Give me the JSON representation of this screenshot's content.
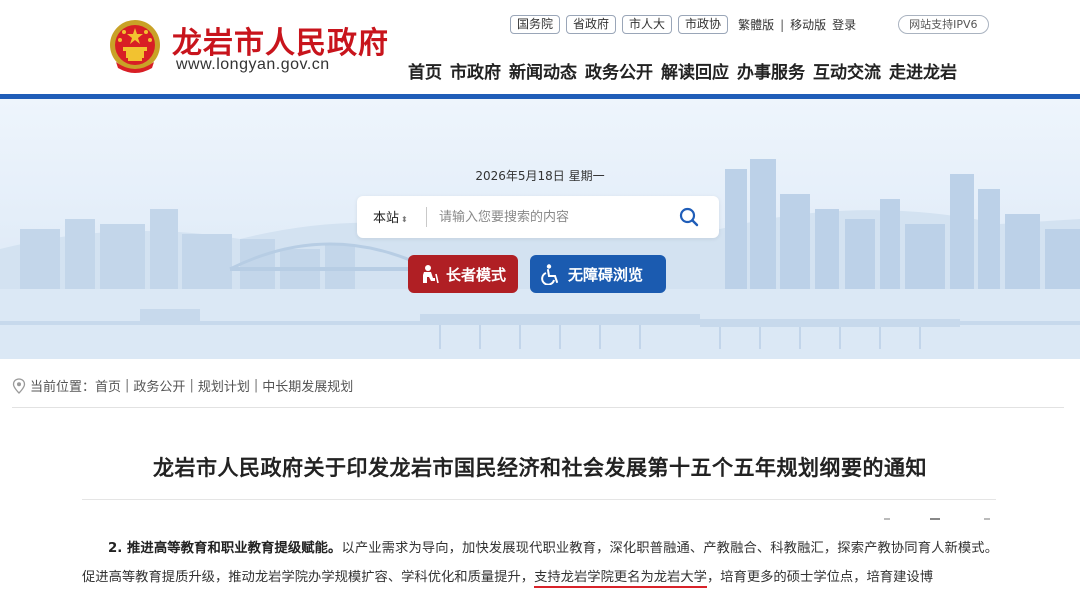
{
  "header": {
    "site_name": "龙岩市人民政府",
    "site_url": "www.longyan.gov.cn",
    "gov_links": [
      "国务院",
      "省政府",
      "市人大",
      "市政协"
    ],
    "traditional": "繁體版",
    "mobile": "移动版",
    "login": "登录",
    "ipv6": "网站支持IPV6",
    "nav": [
      "首页",
      "市政府",
      "新闻动态",
      "政务公开",
      "解读回应",
      "办事服务",
      "互动交流",
      "走进龙岩"
    ]
  },
  "hero": {
    "date": "2026年5月18日 星期一",
    "search_scope": "本站",
    "search_placeholder": "请输入您要搜索的内容",
    "elder_mode": "长者模式",
    "accessible": "无障碍浏览"
  },
  "breadcrumb": {
    "label": "当前位置：",
    "items": [
      "首页",
      "政务公开",
      "规划计划",
      "中长期发展规划"
    ]
  },
  "article": {
    "title": "龙岩市人民政府关于印发龙岩市国民经济和社会发展第十五个五年规划纲要的通知",
    "bold_lead": "2. 推进高等教育和职业教育提级赋能。",
    "text_before": "以产业需求为导向，加快发展现代职业教育，深化职普融通、产教融合、科教融汇，探索产教协同育人新模式。促进高等教育提质升级，推动龙岩学院办学规模扩容、学科优化和质量提升，",
    "highlight": "支持龙岩学院更名为龙岩大学",
    "text_after": "，培育更多的硕士学位点，培育建设博"
  },
  "colors": {
    "brand_red": "#c8141c",
    "nav_blue": "#1f5db8",
    "elder_red": "#b01f24",
    "access_blue": "#1b5bb0"
  },
  "icons": [
    "national-emblem-icon",
    "search-icon",
    "elder-icon",
    "wheelchair-icon",
    "location-icon"
  ]
}
